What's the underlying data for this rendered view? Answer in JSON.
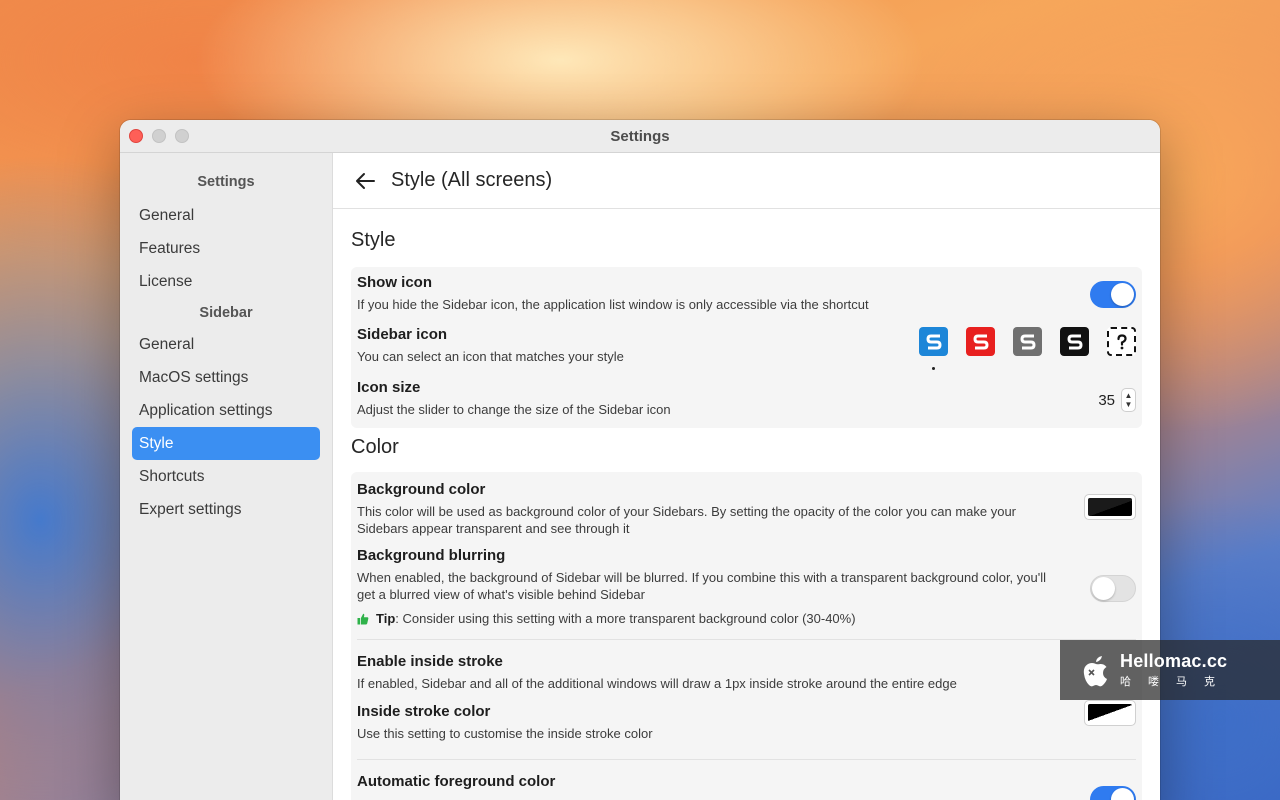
{
  "window": {
    "title": "Settings"
  },
  "sidebar": {
    "header1": "Settings",
    "group1": [
      "General",
      "Features",
      "License"
    ],
    "header2": "Sidebar",
    "group2": [
      "General",
      "MacOS settings",
      "Application settings",
      "Style",
      "Shortcuts",
      "Expert settings"
    ],
    "selected": "Style"
  },
  "main": {
    "title": "Style (All screens)",
    "style_section": {
      "title": "Style",
      "show_icon": {
        "title": "Show icon",
        "desc": "If you hide the Sidebar icon, the application list window is only accessible via the shortcut",
        "enabled": true
      },
      "sidebar_icon": {
        "title": "Sidebar icon",
        "desc": "You can select an icon that matches your style",
        "options": [
          "blue",
          "red",
          "gray",
          "black",
          "custom"
        ],
        "selected": "blue"
      },
      "icon_size": {
        "title": "Icon size",
        "desc": "Adjust the slider to change the size of the Sidebar icon",
        "value": "35"
      }
    },
    "color_section": {
      "title": "Color",
      "background_color": {
        "title": "Background color",
        "desc": "This color will be used as background color of your Sidebars. By setting the opacity of the color you can make your Sidebars appear transparent and see through it"
      },
      "background_blurring": {
        "title": "Background blurring",
        "desc": "When enabled, the background of Sidebar will be blurred. If you combine this with a transparent background color, you'll get a blurred view of what's visible behind Sidebar",
        "enabled": false,
        "tip_label": "Tip",
        "tip_text": ": Consider using this setting with a more transparent background color (30-40%)"
      },
      "inside_stroke": {
        "title": "Enable inside stroke",
        "desc": "If enabled, Sidebar and all of the additional windows will draw a 1px inside stroke around the entire edge"
      },
      "inside_stroke_color": {
        "title": "Inside stroke color",
        "desc": "Use this setting to customise the inside stroke color"
      },
      "auto_foreground": {
        "title": "Automatic foreground color",
        "enabled": true
      }
    }
  },
  "watermark": {
    "brand": "Hellomac.cc",
    "sub": "哈喽马克"
  },
  "colors": {
    "accent": "#3b8ff2",
    "toggle_on": "#2f7bf0",
    "icon_blue": "#1d86d8",
    "icon_red": "#e8201f",
    "icon_gray": "#707070",
    "icon_black": "#111111"
  }
}
